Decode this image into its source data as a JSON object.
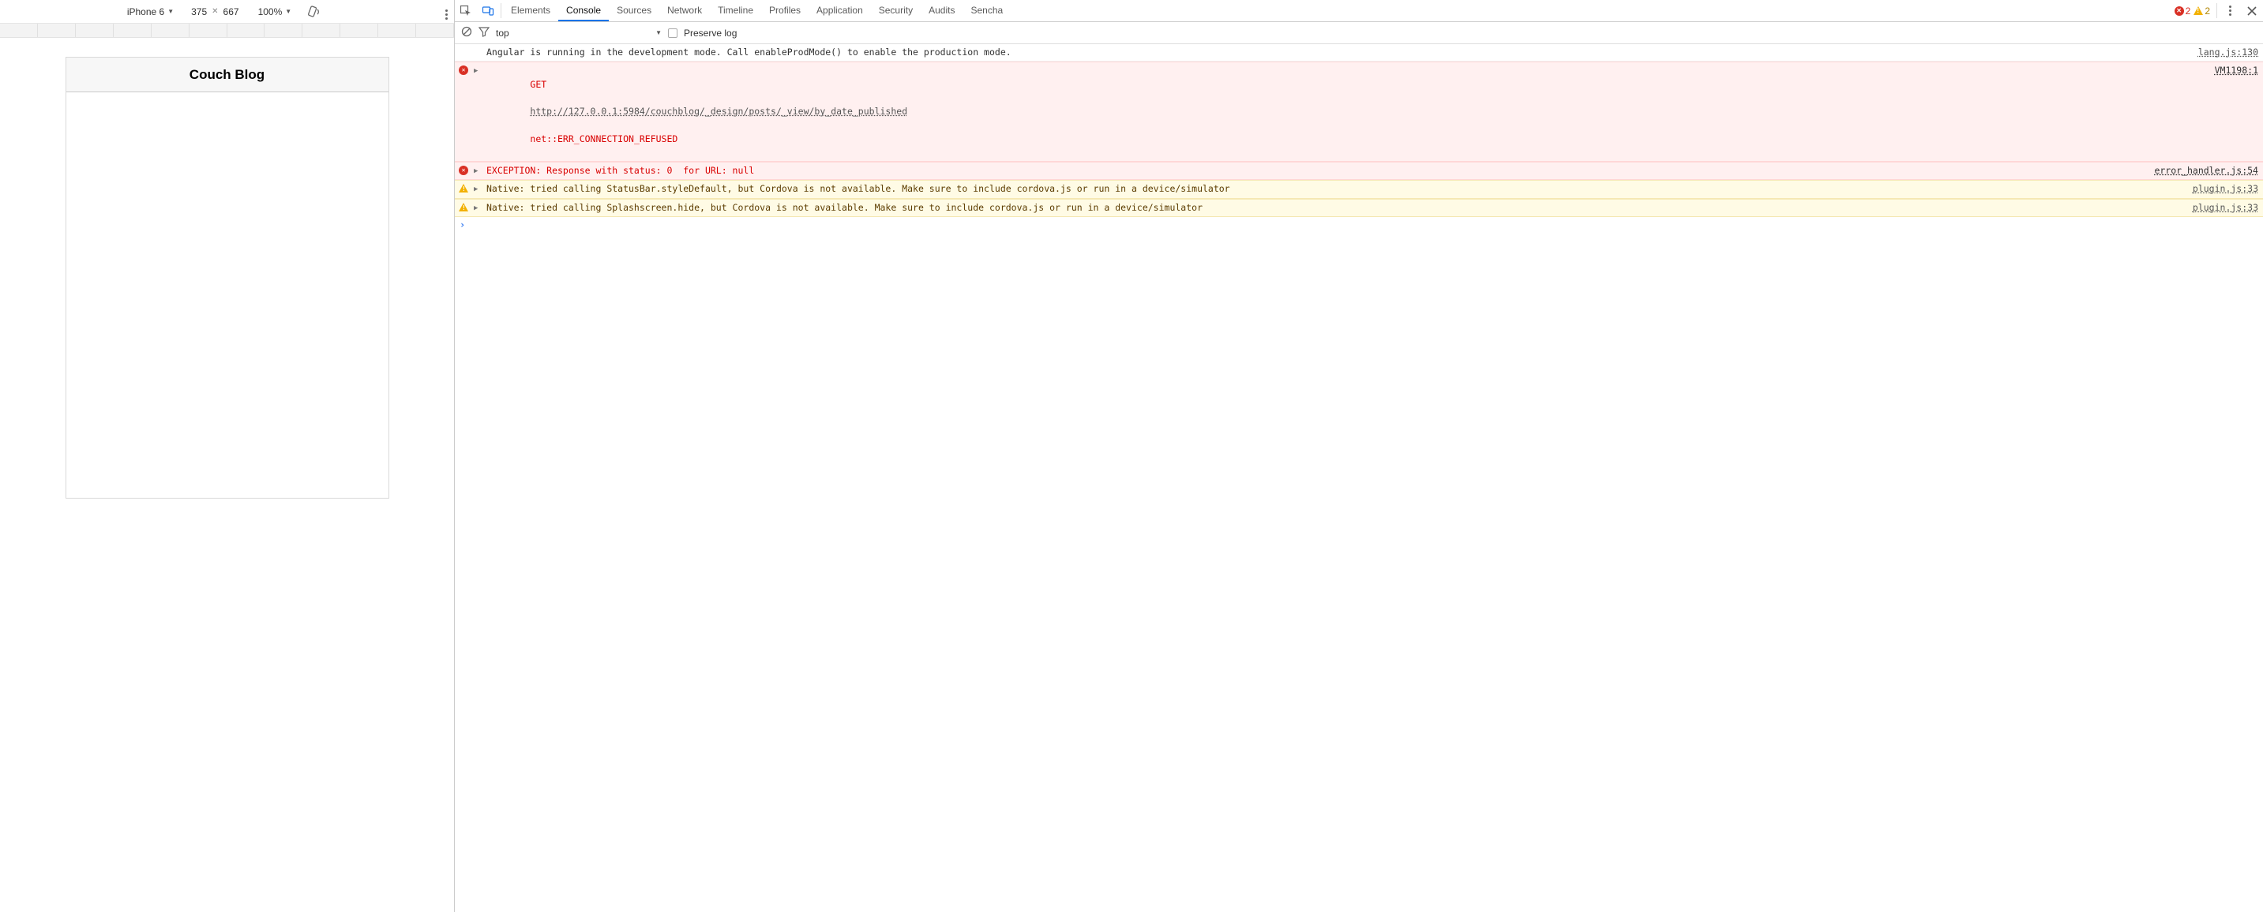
{
  "device_bar": {
    "device": "iPhone 6",
    "width": "375",
    "height": "667",
    "zoom": "100%"
  },
  "app": {
    "title": "Couch Blog"
  },
  "devtools": {
    "tabs": [
      "Elements",
      "Console",
      "Sources",
      "Network",
      "Timeline",
      "Profiles",
      "Application",
      "Security",
      "Audits",
      "Sencha"
    ],
    "active_tab": "Console",
    "errors": "2",
    "warnings": "2"
  },
  "console_bar": {
    "context": "top",
    "preserve_label": "Preserve log"
  },
  "logs": [
    {
      "level": "info",
      "text": "Angular is running in the development mode. Call enableProdMode() to enable the production mode.",
      "source": "lang.js:130"
    },
    {
      "level": "error",
      "method": "GET",
      "url": "http://127.0.0.1:5984/couchblog/_design/posts/_view/by_date_published",
      "neterr": "net::ERR_CONNECTION_REFUSED",
      "source": "VM1198:1"
    },
    {
      "level": "error",
      "text": "EXCEPTION: Response with status: 0  for URL: null",
      "source": "error_handler.js:54"
    },
    {
      "level": "warn",
      "text": "Native: tried calling StatusBar.styleDefault, but Cordova is not available. Make sure to include cordova.js or run in a device/simulator",
      "source": "plugin.js:33"
    },
    {
      "level": "warn",
      "text": "Native: tried calling Splashscreen.hide, but Cordova is not available. Make sure to include cordova.js or run in a device/simulator",
      "source": "plugin.js:33"
    }
  ]
}
